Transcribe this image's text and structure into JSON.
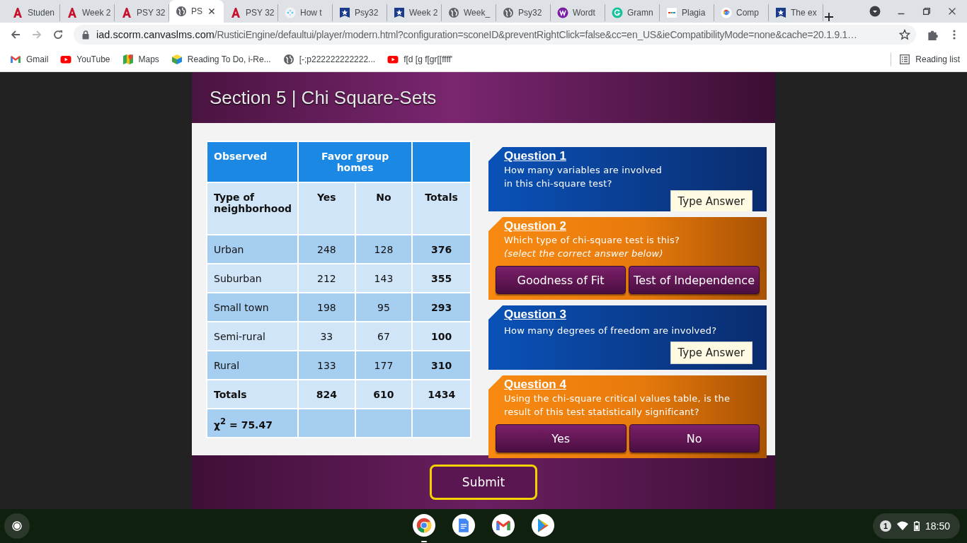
{
  "browser": {
    "tabs": [
      {
        "title": "Studen",
        "kind": "a-logo",
        "selected": false
      },
      {
        "title": "Week 2",
        "kind": "a-logo",
        "selected": false
      },
      {
        "title": "PSY 32",
        "kind": "a-logo",
        "selected": false
      },
      {
        "title": "PS",
        "kind": "globe",
        "selected": true
      },
      {
        "title": "PSY 32",
        "kind": "a-logo",
        "selected": false
      },
      {
        "title": "How t",
        "kind": "dots",
        "selected": false
      },
      {
        "title": "Psy32",
        "kind": "star-shield",
        "selected": false
      },
      {
        "title": "Week 2",
        "kind": "star-shield",
        "selected": false
      },
      {
        "title": "Week_",
        "kind": "globe",
        "selected": false
      },
      {
        "title": "Psy32",
        "kind": "globe",
        "selected": false
      },
      {
        "title": "Wordt",
        "kind": "w-circle",
        "selected": false
      },
      {
        "title": "Gramn",
        "kind": "g-circle",
        "selected": false
      },
      {
        "title": "Plagia",
        "kind": "sst",
        "selected": false
      },
      {
        "title": "Comp",
        "kind": "google",
        "selected": false
      },
      {
        "title": "The ex",
        "kind": "star-shield",
        "selected": false
      }
    ],
    "url_host": "iad.scorm.canvaslms.com",
    "url_path": "/RusticiEngine/defaultui/player/modern.html?configuration=sconeID&preventRightClick=false&cc=en_US&ieCompatibilityMode=none&cache=20.1.9.1…",
    "bookmarks": [
      {
        "label": "Gmail",
        "kind": "gmail"
      },
      {
        "label": "YouTube",
        "kind": "youtube"
      },
      {
        "label": "Maps",
        "kind": "maps"
      },
      {
        "label": "Reading To Do, i-Re...",
        "kind": "cube"
      },
      {
        "label": "[-;p222222222222...",
        "kind": "globe"
      },
      {
        "label": "f[d [g f[gr[[ffff'",
        "kind": "youtube"
      }
    ],
    "reading_list": "Reading list"
  },
  "slide": {
    "title": "Section 5 | Chi Square-Sets",
    "table": {
      "header": [
        "Observed",
        "Favor group homes"
      ],
      "columns": [
        "Type of neighborhood",
        "Yes",
        "No",
        "Totals"
      ],
      "rows": [
        {
          "kind": "data",
          "cells": [
            "Urban",
            "248",
            "128",
            "376"
          ]
        },
        {
          "kind": "data",
          "cells": [
            "Suburban",
            "212",
            "143",
            "355"
          ]
        },
        {
          "kind": "data",
          "cells": [
            "Small town",
            "198",
            "95",
            "293"
          ]
        },
        {
          "kind": "data",
          "cells": [
            "Semi-rural",
            "33",
            "67",
            "100"
          ]
        },
        {
          "kind": "data",
          "cells": [
            "Rural",
            "133",
            "177",
            "310"
          ]
        },
        {
          "kind": "total",
          "cells": [
            "Totals",
            "824",
            "610",
            "1434"
          ]
        },
        {
          "kind": "stat",
          "cells": [
            "χ$^{2}$ = 75.47"
          ]
        }
      ]
    },
    "questions": [
      {
        "kind": "text-answer",
        "title": "Question 1",
        "text": "How many variables are involved in this chi-square test?",
        "answers": [
          "Type Answer"
        ]
      },
      {
        "kind": "choice",
        "title": "Question 2",
        "text": "Which type of chi-square test is this?",
        "hint": "(select the correct answer below)",
        "answers": [
          "Goodness of Fit",
          "Test of Independence"
        ]
      },
      {
        "kind": "text-answer",
        "title": "Question 3",
        "text": "How many degrees of freedom are involved?",
        "answers": [
          "Type Answer"
        ]
      },
      {
        "kind": "choice",
        "title": "Question 4",
        "text": "Using the chi-square critical values table, is the result of this test statistically significant?",
        "answers": [
          "Yes",
          "No"
        ]
      }
    ],
    "submit": "Submit"
  },
  "shelf": {
    "apps": [
      {
        "kind": "chrome",
        "running": true
      },
      {
        "kind": "docs",
        "running": false
      },
      {
        "kind": "gmail",
        "running": false
      },
      {
        "kind": "play",
        "running": false
      }
    ],
    "notifications": "1",
    "time": "18:50"
  }
}
